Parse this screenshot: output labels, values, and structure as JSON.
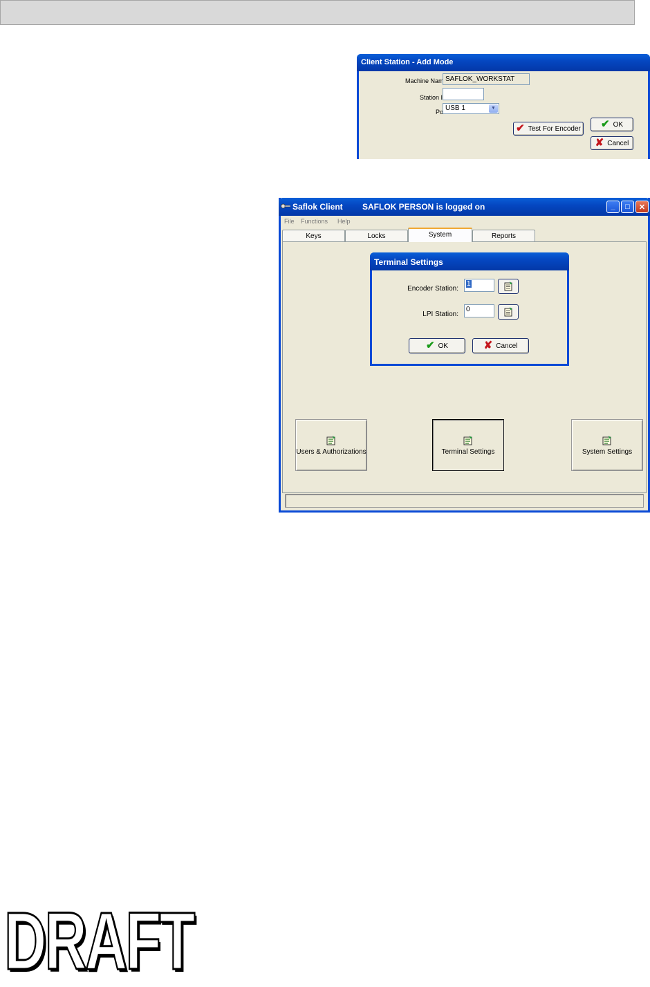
{
  "client_station": {
    "title": "Client Station - Add Mode",
    "machine_name_label": "Machine Name:",
    "machine_name_value": "SAFLOK_WORKSTAT",
    "station_id_label": "Station ID:",
    "station_id_value": "",
    "port_label": "Port:",
    "port_value": "USB 1",
    "test_encoder_label": "Test For Encoder",
    "ok_label": "OK",
    "cancel_label": "Cancel"
  },
  "main_window": {
    "app_title": "Saflok Client",
    "user_status": "SAFLOK PERSON is logged on",
    "menu": [
      "File",
      "Functions",
      "Help"
    ],
    "tabs": [
      "Keys",
      "Locks",
      "System",
      "Reports"
    ],
    "active_tab": "System",
    "buttons": {
      "users": "Users & Authorizations",
      "terminal": "Terminal Settings",
      "system": "System Settings"
    },
    "status_text": ""
  },
  "terminal_settings": {
    "title": "Terminal Settings",
    "encoder_station_label": "Encoder Station:",
    "encoder_station_value": "1",
    "lpi_station_label": "LPI Station:",
    "lpi_station_value": "0",
    "ok_label": "OK",
    "cancel_label": "Cancel"
  },
  "watermark": "DRAFT"
}
